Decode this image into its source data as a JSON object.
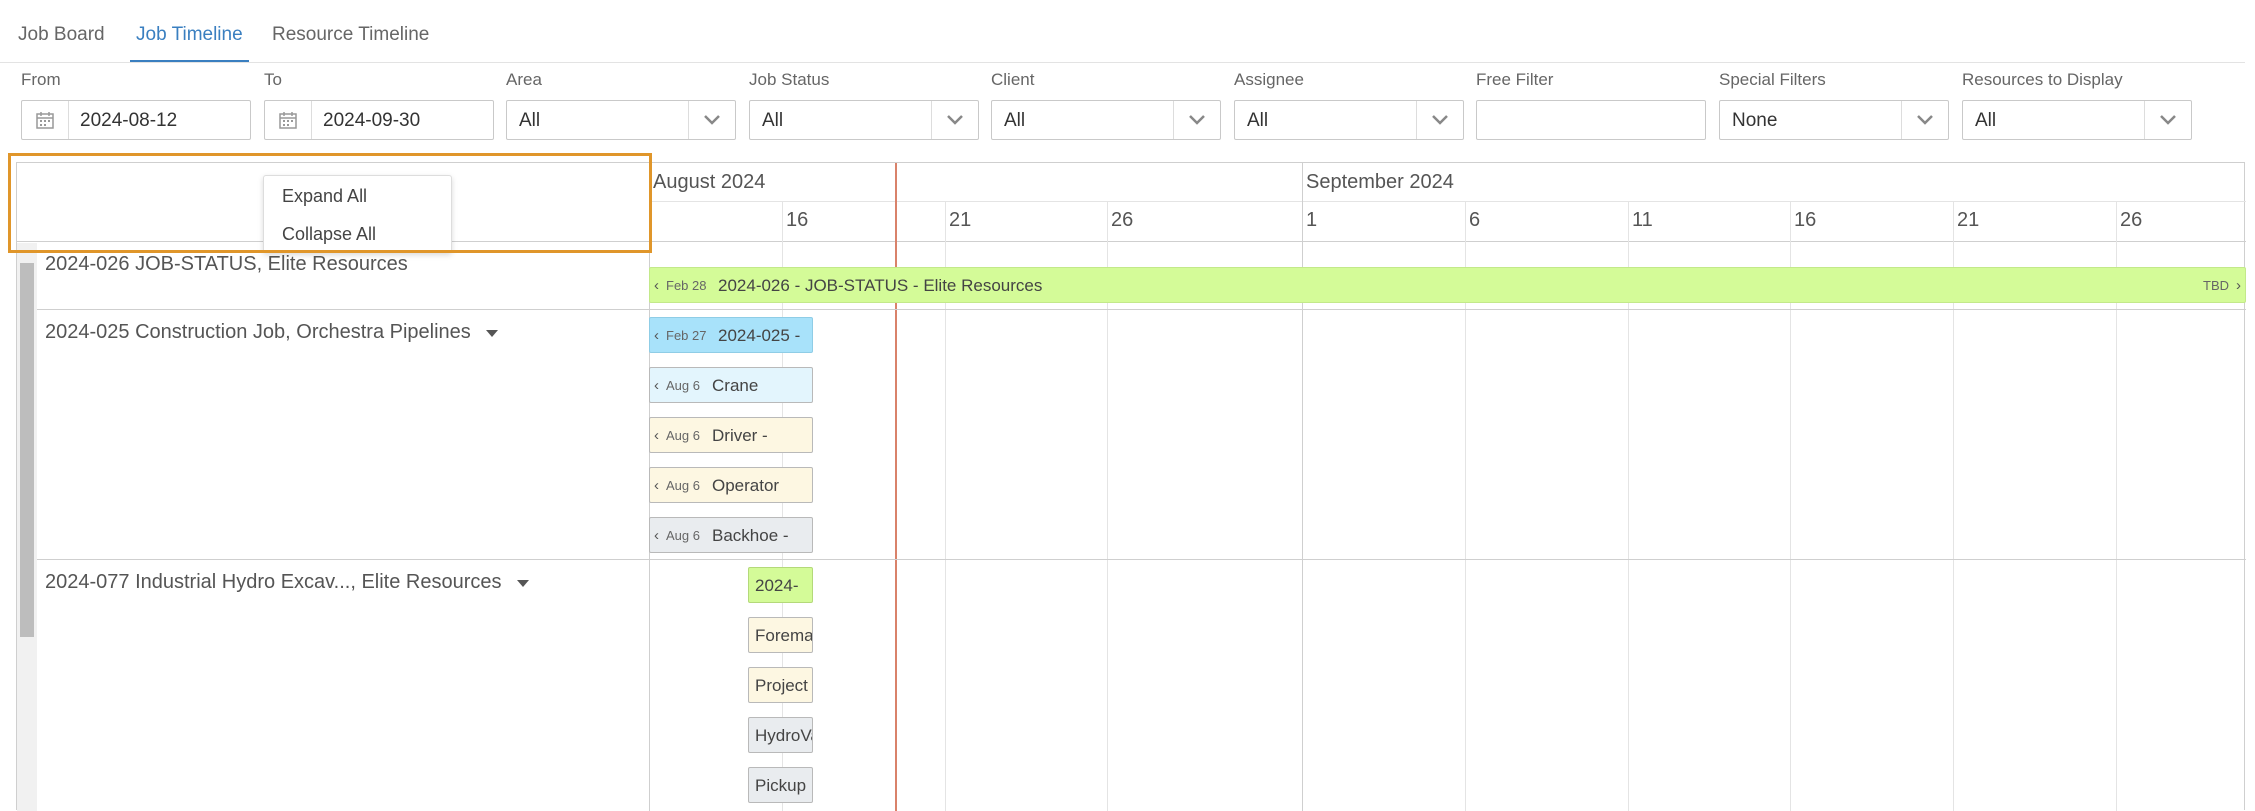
{
  "tabs": [
    "Job Board",
    "Job Timeline",
    "Resource Timeline"
  ],
  "filters": {
    "from": {
      "label": "From",
      "value": "2024-08-12"
    },
    "to": {
      "label": "To",
      "value": "2024-09-30"
    },
    "area": {
      "label": "Area",
      "value": "All"
    },
    "job_status": {
      "label": "Job Status",
      "value": "All"
    },
    "client": {
      "label": "Client",
      "value": "All"
    },
    "assignee": {
      "label": "Assignee",
      "value": "All"
    },
    "free_filter": {
      "label": "Free Filter",
      "value": ""
    },
    "special_filters": {
      "label": "Special Filters",
      "value": "None"
    },
    "resources": {
      "label": "Resources to Display",
      "value": "All"
    }
  },
  "timeline": {
    "months": [
      "August 2024",
      "September 2024"
    ],
    "days": [
      "16",
      "21",
      "26",
      "1",
      "6",
      "11",
      "16",
      "21",
      "26"
    ]
  },
  "context_menu": {
    "expand": "Expand All",
    "collapse": "Collapse All"
  },
  "rows": [
    {
      "label": "2024-026 JOB-STATUS, Elite Resources"
    },
    {
      "label": "2024-025 Construction Job, Orchestra Pipelines"
    },
    {
      "label": "2024-077 Industrial Hydro Excav..., Elite Resources"
    }
  ],
  "bars": {
    "job026": {
      "date": "Feb 28",
      "name": "2024-026 - JOB-STATUS - Elite Resources",
      "end": "TBD"
    },
    "job025": {
      "date": "Feb 27",
      "name": "2024-025 -"
    },
    "crane": {
      "date": "Aug 6",
      "name": "Crane"
    },
    "driver": {
      "date": "Aug 6",
      "name": "Driver -"
    },
    "operator": {
      "date": "Aug 6",
      "name": "Operator"
    },
    "backhoe": {
      "date": "Aug 6",
      "name": "Backhoe -"
    },
    "job077": {
      "name": "2024-"
    },
    "foreman": {
      "name": "Forema"
    },
    "project": {
      "name": "Project"
    },
    "hydrovac": {
      "name": "HydroVa"
    },
    "pickup": {
      "name": "Pickup"
    }
  },
  "colors": {
    "accent": "#3a7fc0",
    "today_line": "#d9826a",
    "job_bar_green": "#d4fb98",
    "job_bar_blue": "#a8e2fa",
    "crane_bar": "#e3f5fd",
    "role_bar": "#fdf7e2",
    "equipment_bar": "#e9ecef",
    "highlight": "#e0962a"
  }
}
